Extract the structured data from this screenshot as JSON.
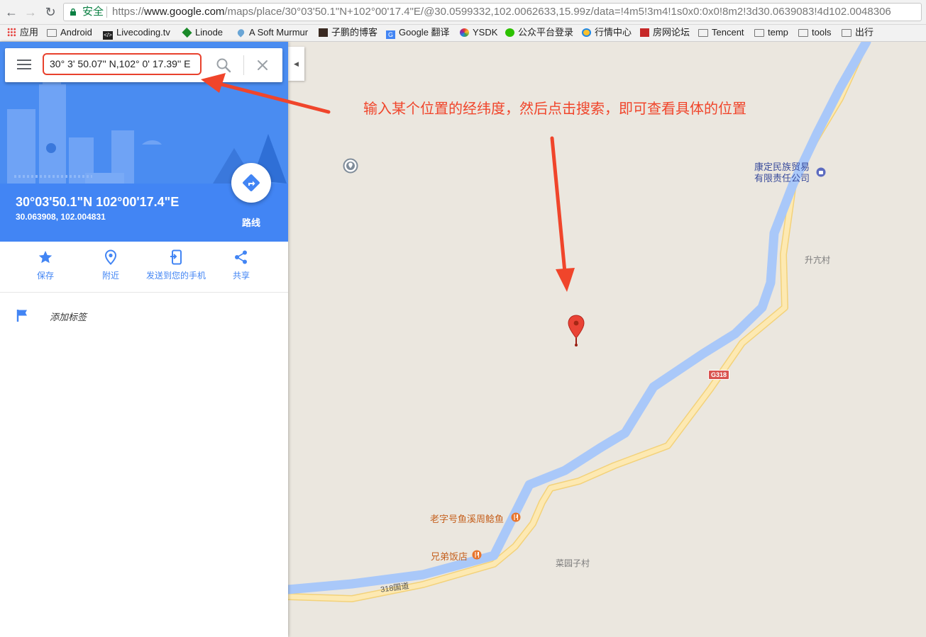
{
  "browser": {
    "secure_label": "安全",
    "url_scheme": "https://",
    "url_host": "www.google.com",
    "url_path": "/maps/place/30°03'50.1\"N+102°00'17.4\"E/@30.0599332,102.0062633,15.99z/data=!4m5!3m4!1s0x0:0x0!8m2!3d30.0639083!4d102.0048306"
  },
  "bookmarks": [
    {
      "label": "应用",
      "icon": "apps-grid-icon"
    },
    {
      "label": "Android",
      "icon": "folder-icon"
    },
    {
      "label": "Livecoding.tv",
      "icon": "code-icon"
    },
    {
      "label": "Linode",
      "icon": "linode-cube-icon"
    },
    {
      "label": "A Soft Murmur",
      "icon": "droplet-icon"
    },
    {
      "label": "子鹏的博客",
      "icon": "avatar-icon"
    },
    {
      "label": "Google 翻译",
      "icon": "translate-icon"
    },
    {
      "label": "YSDK",
      "icon": "ysdk-ring-icon"
    },
    {
      "label": "公众平台登录",
      "icon": "wechat-icon"
    },
    {
      "label": "行情中心",
      "icon": "market-icon"
    },
    {
      "label": "房网论坛",
      "icon": "forum-icon"
    },
    {
      "label": "Tencent",
      "icon": "folder-icon"
    },
    {
      "label": "temp",
      "icon": "folder-icon"
    },
    {
      "label": "tools",
      "icon": "folder-icon"
    },
    {
      "label": "出行",
      "icon": "folder-icon"
    }
  ],
  "search": {
    "query": "30° 3' 50.07'' N,102° 0' 17.39'' E"
  },
  "place": {
    "title": "30°03'50.1\"N 102°00'17.4\"E",
    "coordinates": "30.063908, 102.004831"
  },
  "route": {
    "label": "路线"
  },
  "actions": [
    {
      "label": "保存",
      "icon": "star-icon"
    },
    {
      "label": "附近",
      "icon": "nearby-pin-icon"
    },
    {
      "label": "发送到您的手机",
      "icon": "send-to-phone-icon"
    },
    {
      "label": "共享",
      "icon": "share-icon"
    }
  ],
  "add_label": "添加标签",
  "annotation": "输入某个位置的经纬度，然后点击搜索，即可查看具体的位置",
  "map": {
    "labels": {
      "company_line1": "康定民族贸易",
      "company_line2": "有限责任公司",
      "village1": "升亢村",
      "restaurant1": "老字号鱼溪周鲶鱼",
      "restaurant2": "兄弟饭店",
      "village2": "菜园子村",
      "road": "318国道",
      "shield": "G318"
    }
  },
  "colors": {
    "accent": "#4285f4",
    "annotation": "#f0452b",
    "river": "#a9c8f9",
    "road": "#fbe3a3",
    "map_bg": "#ebe7df",
    "poi_orange": "#e8742c",
    "poi_blue": "#5c6bc0"
  }
}
